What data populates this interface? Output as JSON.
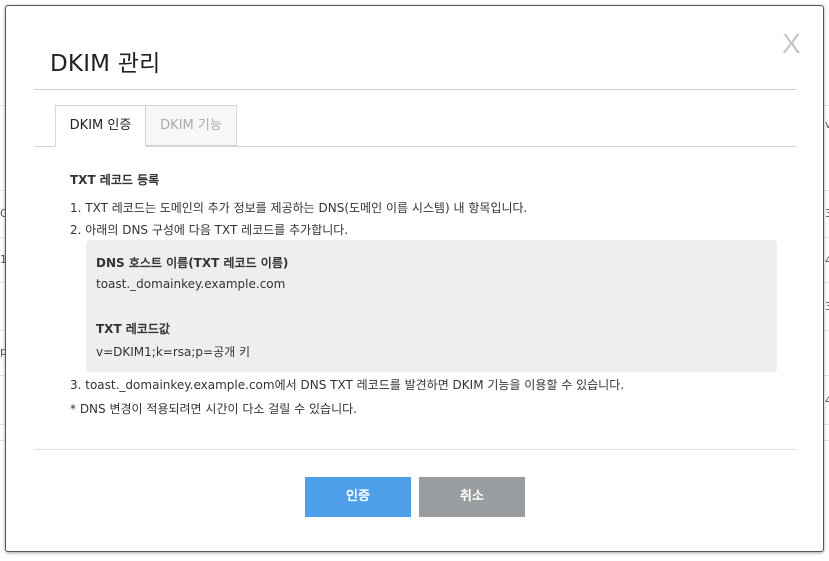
{
  "dialog": {
    "title": "DKIM 관리",
    "close_label": "X"
  },
  "tabs": [
    {
      "label": "DKIM 인증",
      "active": true
    },
    {
      "label": "DKIM 기능",
      "active": false
    }
  ],
  "content": {
    "section_title": "TXT 레코드 등록",
    "step1": "1. TXT 레코드는 도메인의 추가 정보를 제공하는 DNS(도메인 이름 시스템) 내 항목입니다.",
    "step2": "2. 아래의 DNS 구성에 다음 TXT 레코드를 추가합니다.",
    "dns_host_label": "DNS 호스트 이름(TXT 레코드 이름)",
    "dns_host_value": "toast._domainkey.example.com",
    "txt_value_label": "TXT 레코드값",
    "txt_value": "v=DKIM1;k=rsa;p=공개 키",
    "step3": "3. toast._domainkey.example.com에서 DNS TXT 레코드를 발견하면 DKIM 기능을 이용할 수 있습니다.",
    "note": "* DNS 변경이 적용되려면 시간이 다소 걸릴 수 있습니다."
  },
  "buttons": {
    "confirm": "인증",
    "cancel": "취소"
  },
  "background_fragments": [
    "v",
    "G",
    "1",
    "3",
    "4",
    "3",
    "p",
    "4"
  ],
  "colors": {
    "primary_button": "#4f9eea",
    "secondary_button": "#9a9d9f",
    "code_box_bg": "#eeeeee"
  }
}
